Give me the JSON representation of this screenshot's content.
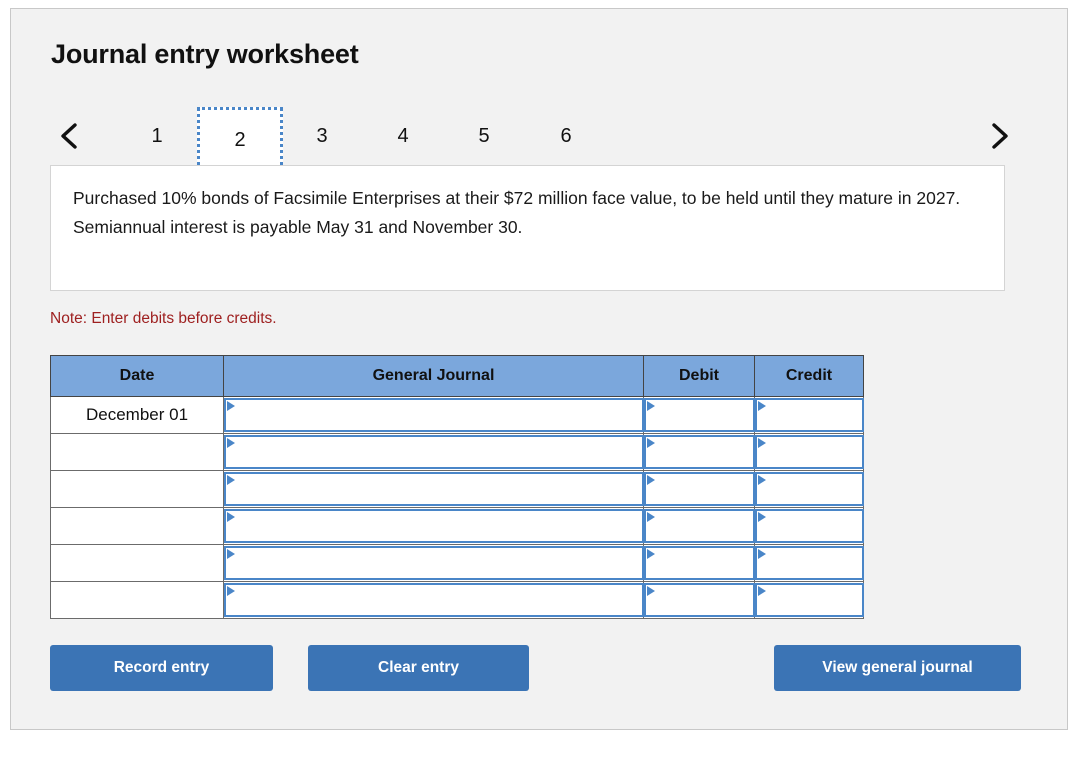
{
  "page_title": "Journal entry worksheet",
  "pager": {
    "prev_icon": "chevron-left-icon",
    "next_icon": "chevron-right-icon",
    "pages": [
      "1",
      "2",
      "3",
      "4",
      "5",
      "6"
    ],
    "active_page": "2"
  },
  "description": "Purchased 10% bonds of Facsimile Enterprises at their $72 million face value, to be held until they mature in 2027. Semiannual interest is payable May 31 and November 30.",
  "note": "Note: Enter debits before credits.",
  "table": {
    "columns": [
      "Date",
      "General Journal",
      "Debit",
      "Credit"
    ],
    "rows": [
      {
        "date": "December 01",
        "general_journal": "",
        "debit": "",
        "credit": ""
      },
      {
        "date": "",
        "general_journal": "",
        "debit": "",
        "credit": ""
      },
      {
        "date": "",
        "general_journal": "",
        "debit": "",
        "credit": ""
      },
      {
        "date": "",
        "general_journal": "",
        "debit": "",
        "credit": ""
      },
      {
        "date": "",
        "general_journal": "",
        "debit": "",
        "credit": ""
      },
      {
        "date": "",
        "general_journal": "",
        "debit": "",
        "credit": ""
      }
    ]
  },
  "buttons": {
    "record": "Record entry",
    "clear": "Clear entry",
    "view": "View general journal"
  },
  "colors": {
    "panel_background": "#f2f2f2",
    "header_blue": "#7ba7dc",
    "button_blue": "#3b74b5",
    "note_red": "#9e2020",
    "input_border_blue": "#4a86c8"
  }
}
